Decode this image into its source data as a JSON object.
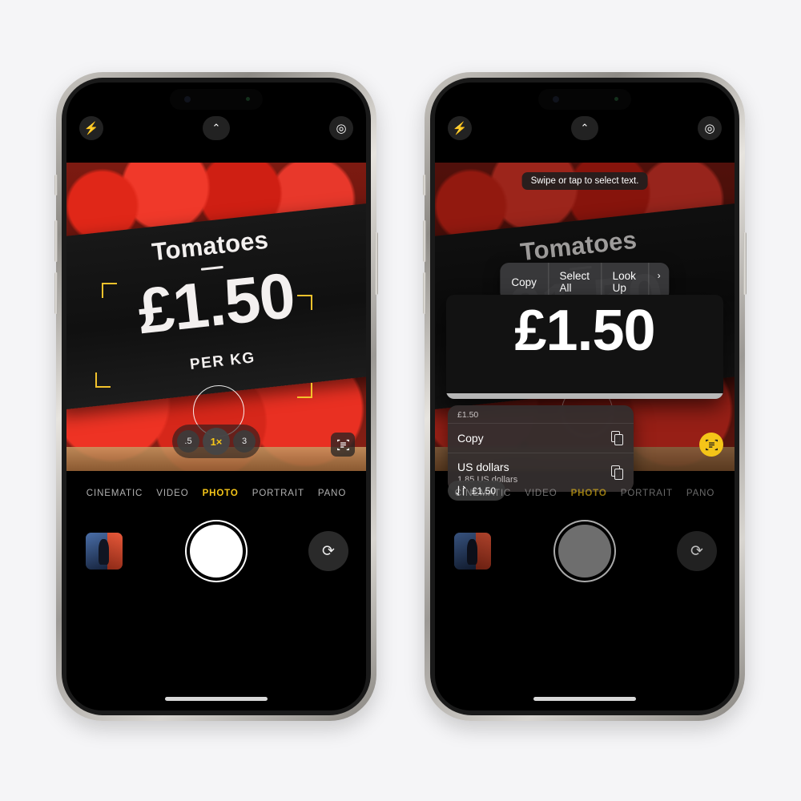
{
  "meta": {
    "background_color": "#f5f5f7",
    "accent_yellow": "#f5c518"
  },
  "sign": {
    "title": "Tomatoes",
    "price": "£1.50",
    "unit": "PER KG"
  },
  "camera": {
    "icons": {
      "flash": "flash-icon",
      "chevron": "chevron-up-icon",
      "live_photo": "live-photo-icon",
      "live_text": "live-text-icon",
      "flip": "camera-flip-icon"
    },
    "zoom_options": [
      ".5",
      "1×",
      "3"
    ],
    "zoom_selected": "1×",
    "modes": [
      "CINEMATIC",
      "VIDEO",
      "PHOTO",
      "PORTRAIT",
      "PANO"
    ],
    "mode_selected": "PHOTO"
  },
  "left_phone": {
    "name": "iphone-camera-live-text-detected"
  },
  "right_phone": {
    "name": "iphone-camera-live-text-selected",
    "toast": "Swipe or tap to select text.",
    "context_menu": {
      "items": [
        "Copy",
        "Select All",
        "Look Up"
      ],
      "more_arrow": "›"
    },
    "magnifier_text": "£1.50",
    "data_sheet": {
      "header": "£1.50",
      "rows": [
        {
          "label": "Copy",
          "sublabel": "",
          "icon": "copy-icon"
        },
        {
          "label": "US dollars",
          "sublabel": "1.85 US dollars",
          "icon": "copy-icon"
        }
      ]
    },
    "currency_chip": {
      "icon": "currency-convert-icon",
      "label": "£1.50"
    }
  }
}
